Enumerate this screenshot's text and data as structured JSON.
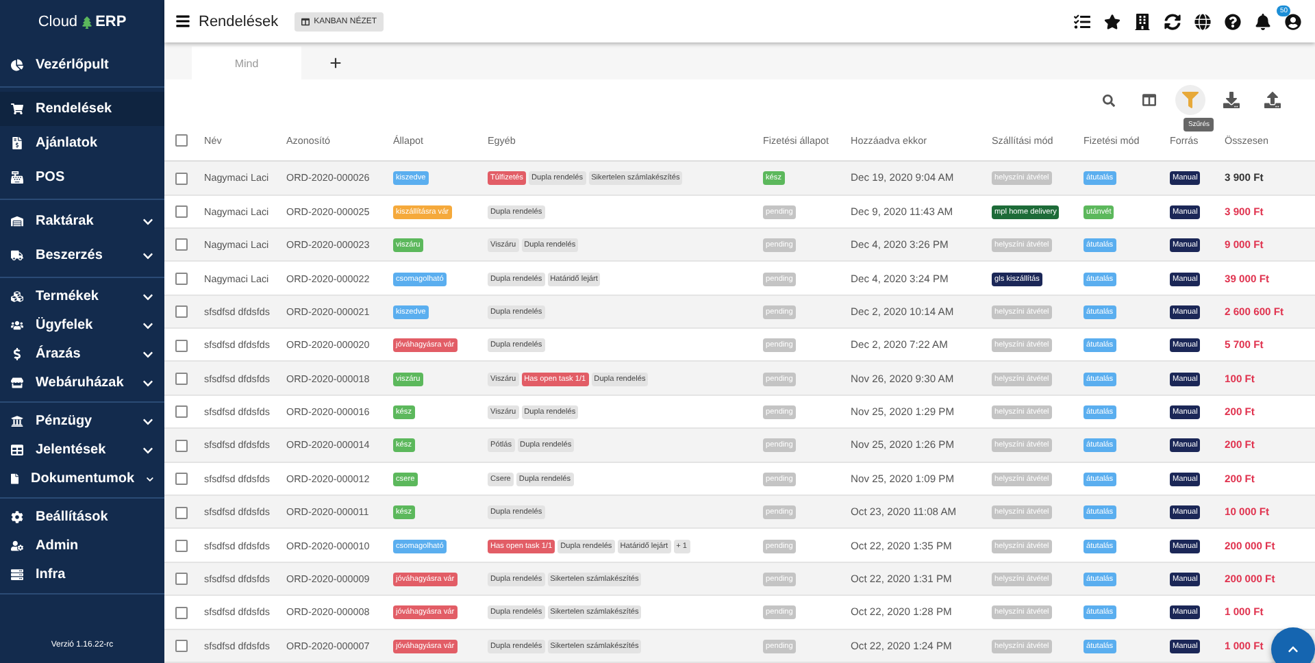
{
  "brand": {
    "left": "Cloud",
    "right": "ERP"
  },
  "sidebar": {
    "groups": [
      [
        {
          "label": "Vezérlőpult",
          "expandable": false,
          "selected": false
        }
      ],
      [
        {
          "label": "Rendelések",
          "expandable": false,
          "selected": true
        },
        {
          "label": "Ajánlatok",
          "expandable": false,
          "selected": false
        },
        {
          "label": "POS",
          "expandable": false,
          "selected": false
        }
      ],
      [
        {
          "label": "Raktárak",
          "expandable": true,
          "selected": false
        },
        {
          "label": "Beszerzés",
          "expandable": true,
          "selected": false
        }
      ],
      [
        {
          "label": "Termékek",
          "expandable": true,
          "selected": false
        },
        {
          "label": "Ügyfelek",
          "expandable": true,
          "selected": false
        },
        {
          "label": "Árazás",
          "expandable": true,
          "selected": false
        },
        {
          "label": "Webáruházak",
          "expandable": true,
          "selected": false
        }
      ],
      [
        {
          "label": "Pénzügy",
          "expandable": true,
          "selected": false
        },
        {
          "label": "Jelentések",
          "expandable": true,
          "selected": false
        },
        {
          "label": "Dokumentumok",
          "expandable": true,
          "selected": false
        }
      ],
      [
        {
          "label": "Beállítások",
          "expandable": false,
          "selected": false
        },
        {
          "label": "Admin",
          "expandable": false,
          "selected": false
        },
        {
          "label": "Infra",
          "expandable": false,
          "selected": false
        }
      ]
    ],
    "version": "Verzió 1.16.22-rc"
  },
  "header": {
    "title": "Rendelések",
    "view_button": "KANBAN NÉZET",
    "notification_count": "50"
  },
  "tabs": [
    {
      "label": "Mind",
      "selected": true
    },
    {
      "label": "+",
      "selected": false
    }
  ],
  "toolbar": {
    "tooltip": "Szűrés"
  },
  "table": {
    "select_all_checked": false,
    "columns": [
      "Név",
      "Azonosító",
      "Állapot",
      "Egyéb",
      "Fizetési állapot",
      "Hozzáadva ekkor",
      "Szállítási mód",
      "Fizetési mód",
      "Forrás",
      "Összesen"
    ],
    "rows": [
      {
        "checked": false,
        "name": "Nagymaci Laci",
        "id": "ORD-2020-000026",
        "status": {
          "label": "kiszedve",
          "color": "#5aaeef"
        },
        "tags": [
          {
            "label": "Túlfizetés",
            "kind": "alert"
          },
          {
            "label": "Dupla rendelés",
            "kind": "plain"
          },
          {
            "label": "Sikertelen számlakészítés",
            "kind": "plain"
          }
        ],
        "payment_status": {
          "label": "kész",
          "color": "#5cb85c"
        },
        "added": "Dec 19, 2020 9:04 AM",
        "shipping": {
          "label": "helyszíni átvétel",
          "color": "#c4c4c4"
        },
        "payment": {
          "label": "átutalás",
          "color": "#5aaeef"
        },
        "source": "Manual",
        "total": "3 900 Ft",
        "highlighted": false
      },
      {
        "checked": false,
        "name": "Nagymaci Laci",
        "id": "ORD-2020-000025",
        "status": {
          "label": "kiszállításra vár",
          "color": "#f5a93b"
        },
        "tags": [
          {
            "label": "Dupla rendelés",
            "kind": "plain"
          }
        ],
        "payment_status": {
          "label": "pending",
          "color": "#c4c4c4"
        },
        "added": "Dec 9, 2020 11:43 AM",
        "shipping": {
          "label": "mpl home delivery",
          "color": "#1d6b38"
        },
        "payment": {
          "label": "utánvét",
          "color": "#5cb85c"
        },
        "source": "Manual",
        "total": "3 900 Ft",
        "highlighted": true
      },
      {
        "checked": false,
        "name": "Nagymaci Laci",
        "id": "ORD-2020-000023",
        "status": {
          "label": "viszáru",
          "color": "#5cb85c"
        },
        "tags": [
          {
            "label": "Viszáru",
            "kind": "plain"
          },
          {
            "label": "Dupla rendelés",
            "kind": "plain"
          }
        ],
        "payment_status": {
          "label": "pending",
          "color": "#c4c4c4"
        },
        "added": "Dec 4, 2020 3:26 PM",
        "shipping": {
          "label": "helyszíni átvétel",
          "color": "#c4c4c4"
        },
        "payment": {
          "label": "átutalás",
          "color": "#5aaeef"
        },
        "source": "Manual",
        "total": "9 000 Ft",
        "highlighted": true
      },
      {
        "checked": false,
        "name": "Nagymaci Laci",
        "id": "ORD-2020-000022",
        "status": {
          "label": "csomagolható",
          "color": "#5aaeef"
        },
        "tags": [
          {
            "label": "Dupla rendelés",
            "kind": "plain"
          },
          {
            "label": "Határidő lejárt",
            "kind": "plain"
          }
        ],
        "payment_status": {
          "label": "pending",
          "color": "#c4c4c4"
        },
        "added": "Dec 4, 2020 3:24 PM",
        "shipping": {
          "label": "gls kiszállítás",
          "color": "#1b2757"
        },
        "payment": {
          "label": "átutalás",
          "color": "#5aaeef"
        },
        "source": "Manual",
        "total": "39 000 Ft",
        "highlighted": true
      },
      {
        "checked": false,
        "name": "sfsdfsd dfdsfds",
        "id": "ORD-2020-000021",
        "status": {
          "label": "kiszedve",
          "color": "#5aaeef"
        },
        "tags": [
          {
            "label": "Dupla rendelés",
            "kind": "plain"
          }
        ],
        "payment_status": {
          "label": "pending",
          "color": "#c4c4c4"
        },
        "added": "Dec 2, 2020 10:14 AM",
        "shipping": {
          "label": "helyszíni átvétel",
          "color": "#c4c4c4"
        },
        "payment": {
          "label": "átutalás",
          "color": "#5aaeef"
        },
        "source": "Manual",
        "total": "2 600 600 Ft",
        "highlighted": true
      },
      {
        "checked": false,
        "name": "sfsdfsd dfdsfds",
        "id": "ORD-2020-000020",
        "status": {
          "label": "jóváhagyásra vár",
          "color": "#e25d66"
        },
        "tags": [
          {
            "label": "Dupla rendelés",
            "kind": "plain"
          }
        ],
        "payment_status": {
          "label": "pending",
          "color": "#c4c4c4"
        },
        "added": "Dec 2, 2020 7:22 AM",
        "shipping": {
          "label": "helyszíni átvétel",
          "color": "#c4c4c4"
        },
        "payment": {
          "label": "átutalás",
          "color": "#5aaeef"
        },
        "source": "Manual",
        "total": "5 700 Ft",
        "highlighted": true
      },
      {
        "checked": false,
        "name": "sfsdfsd dfdsfds",
        "id": "ORD-2020-000018",
        "status": {
          "label": "viszáru",
          "color": "#5cb85c"
        },
        "tags": [
          {
            "label": "Viszáru",
            "kind": "plain"
          },
          {
            "label": "Has open task 1/1",
            "kind": "alert"
          },
          {
            "label": "Dupla rendelés",
            "kind": "plain"
          }
        ],
        "payment_status": {
          "label": "pending",
          "color": "#c4c4c4"
        },
        "added": "Nov 26, 2020 9:30 AM",
        "shipping": {
          "label": "helyszíni átvétel",
          "color": "#c4c4c4"
        },
        "payment": {
          "label": "átutalás",
          "color": "#5aaeef"
        },
        "source": "Manual",
        "total": "100 Ft",
        "highlighted": true
      },
      {
        "checked": false,
        "name": "sfsdfsd dfdsfds",
        "id": "ORD-2020-000016",
        "status": {
          "label": "kész",
          "color": "#5cb85c"
        },
        "tags": [
          {
            "label": "Viszáru",
            "kind": "plain"
          },
          {
            "label": "Dupla rendelés",
            "kind": "plain"
          }
        ],
        "payment_status": {
          "label": "pending",
          "color": "#c4c4c4"
        },
        "added": "Nov 25, 2020 1:29 PM",
        "shipping": {
          "label": "helyszíni átvétel",
          "color": "#c4c4c4"
        },
        "payment": {
          "label": "átutalás",
          "color": "#5aaeef"
        },
        "source": "Manual",
        "total": "200 Ft",
        "highlighted": true
      },
      {
        "checked": false,
        "name": "sfsdfsd dfdsfds",
        "id": "ORD-2020-000014",
        "status": {
          "label": "kész",
          "color": "#5cb85c"
        },
        "tags": [
          {
            "label": "Pótlás",
            "kind": "plain"
          },
          {
            "label": "Dupla rendelés",
            "kind": "plain"
          }
        ],
        "payment_status": {
          "label": "pending",
          "color": "#c4c4c4"
        },
        "added": "Nov 25, 2020 1:26 PM",
        "shipping": {
          "label": "helyszíni átvétel",
          "color": "#c4c4c4"
        },
        "payment": {
          "label": "átutalás",
          "color": "#5aaeef"
        },
        "source": "Manual",
        "total": "200 Ft",
        "highlighted": true
      },
      {
        "checked": false,
        "name": "sfsdfsd dfdsfds",
        "id": "ORD-2020-000012",
        "status": {
          "label": "csere",
          "color": "#5cb85c"
        },
        "tags": [
          {
            "label": "Csere",
            "kind": "plain"
          },
          {
            "label": "Dupla rendelés",
            "kind": "plain"
          }
        ],
        "payment_status": {
          "label": "pending",
          "color": "#c4c4c4"
        },
        "added": "Nov 25, 2020 1:09 PM",
        "shipping": {
          "label": "helyszíni átvétel",
          "color": "#c4c4c4"
        },
        "payment": {
          "label": "átutalás",
          "color": "#5aaeef"
        },
        "source": "Manual",
        "total": "200 Ft",
        "highlighted": true
      },
      {
        "checked": false,
        "name": "sfsdfsd dfdsfds",
        "id": "ORD-2020-000011",
        "status": {
          "label": "kész",
          "color": "#5cb85c"
        },
        "tags": [
          {
            "label": "Dupla rendelés",
            "kind": "plain"
          }
        ],
        "payment_status": {
          "label": "pending",
          "color": "#c4c4c4"
        },
        "added": "Oct 23, 2020 11:08 AM",
        "shipping": {
          "label": "helyszíni átvétel",
          "color": "#c4c4c4"
        },
        "payment": {
          "label": "átutalás",
          "color": "#5aaeef"
        },
        "source": "Manual",
        "total": "10 000 Ft",
        "highlighted": true
      },
      {
        "checked": false,
        "name": "sfsdfsd dfdsfds",
        "id": "ORD-2020-000010",
        "status": {
          "label": "csomagolható",
          "color": "#5aaeef"
        },
        "tags": [
          {
            "label": "Has open task 1/1",
            "kind": "alert"
          },
          {
            "label": "Dupla rendelés",
            "kind": "plain"
          },
          {
            "label": "Határidő lejárt",
            "kind": "plain"
          },
          {
            "label": "+ 1",
            "kind": "plain"
          }
        ],
        "payment_status": {
          "label": "pending",
          "color": "#c4c4c4"
        },
        "added": "Oct 22, 2020 1:35 PM",
        "shipping": {
          "label": "helyszíni átvétel",
          "color": "#c4c4c4"
        },
        "payment": {
          "label": "átutalás",
          "color": "#5aaeef"
        },
        "source": "Manual",
        "total": "200 000 Ft",
        "highlighted": true
      },
      {
        "checked": false,
        "name": "sfsdfsd dfdsfds",
        "id": "ORD-2020-000009",
        "status": {
          "label": "jóváhagyásra vár",
          "color": "#e25d66"
        },
        "tags": [
          {
            "label": "Dupla rendelés",
            "kind": "plain"
          },
          {
            "label": "Sikertelen számlakészítés",
            "kind": "plain"
          }
        ],
        "payment_status": {
          "label": "pending",
          "color": "#c4c4c4"
        },
        "added": "Oct 22, 2020 1:31 PM",
        "shipping": {
          "label": "helyszíni átvétel",
          "color": "#c4c4c4"
        },
        "payment": {
          "label": "átutalás",
          "color": "#5aaeef"
        },
        "source": "Manual",
        "total": "200 000 Ft",
        "highlighted": true
      },
      {
        "checked": false,
        "name": "sfsdfsd dfdsfds",
        "id": "ORD-2020-000008",
        "status": {
          "label": "jóváhagyásra vár",
          "color": "#e25d66"
        },
        "tags": [
          {
            "label": "Dupla rendelés",
            "kind": "plain"
          },
          {
            "label": "Sikertelen számlakészítés",
            "kind": "plain"
          }
        ],
        "payment_status": {
          "label": "pending",
          "color": "#c4c4c4"
        },
        "added": "Oct 22, 2020 1:28 PM",
        "shipping": {
          "label": "helyszíni átvétel",
          "color": "#c4c4c4"
        },
        "payment": {
          "label": "átutalás",
          "color": "#5aaeef"
        },
        "source": "Manual",
        "total": "1 000 Ft",
        "highlighted": true
      },
      {
        "checked": false,
        "name": "sfsdfsd dfdsfds",
        "id": "ORD-2020-000007",
        "status": {
          "label": "jóváhagyásra vár",
          "color": "#e25d66"
        },
        "tags": [
          {
            "label": "Dupla rendelés",
            "kind": "plain"
          },
          {
            "label": "Sikertelen számlakészítés",
            "kind": "plain"
          }
        ],
        "payment_status": {
          "label": "pending",
          "color": "#c4c4c4"
        },
        "added": "Oct 22, 2020 1:24 PM",
        "shipping": {
          "label": "helyszíni átvétel",
          "color": "#c4c4c4"
        },
        "payment": {
          "label": "átutalás",
          "color": "#5aaeef"
        },
        "source": "Manual",
        "total": "1 000 Ft",
        "highlighted": true
      }
    ]
  }
}
